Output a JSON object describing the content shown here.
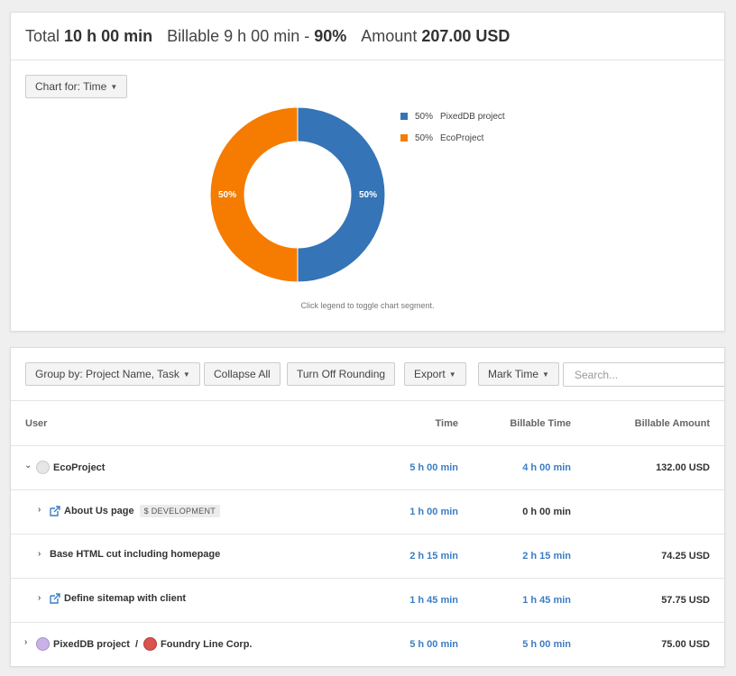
{
  "summary": {
    "total_label": "Total",
    "total_value": "10 h 00 min",
    "billable_label": "Billable",
    "billable_value": "9 h 00 min",
    "billable_sep": "-",
    "billable_pct": "90%",
    "amount_label": "Amount",
    "amount_value": "207.00 USD"
  },
  "chart_controls": {
    "chart_for_label": "Chart for: Time",
    "hint": "Click legend to toggle chart segment."
  },
  "chart_data": {
    "type": "pie",
    "donut": true,
    "categories": [
      "PixedDB project",
      "EcoProject"
    ],
    "values": [
      50,
      50
    ],
    "colors": [
      "#3574b6",
      "#f57c00"
    ],
    "slice_labels": [
      "50%",
      "50%"
    ],
    "legend": [
      {
        "pct": "50%",
        "name": "PixedDB project",
        "color": "#3574b6"
      },
      {
        "pct": "50%",
        "name": "EcoProject",
        "color": "#f57c00"
      }
    ],
    "legend_position": "right"
  },
  "toolbar": {
    "group_by_label": "Group by: Project Name, Task",
    "collapse_all_label": "Collapse All",
    "rounding_label": "Turn Off Rounding",
    "export_label": "Export",
    "mark_time_label": "Mark Time",
    "search_placeholder": "Search..."
  },
  "table": {
    "headers": {
      "user": "User",
      "time": "Time",
      "billable_time": "Billable Time",
      "billable_amount": "Billable Amount"
    },
    "rows": [
      {
        "name": "EcoProject",
        "time": "5 h 00 min",
        "billable_time": "4 h 00 min",
        "amount": "132.00 USD"
      },
      {
        "name": "About Us page",
        "tag": "$ DEVELOPMENT",
        "time": "1 h 00 min",
        "billable_time": "0 h 00 min",
        "amount": ""
      },
      {
        "name": "Base HTML cut including homepage",
        "time": "2 h 15 min",
        "billable_time": "2 h 15 min",
        "amount": "74.25 USD"
      },
      {
        "name": "Define sitemap with client",
        "time": "1 h 45 min",
        "billable_time": "1 h 45 min",
        "amount": "57.75 USD"
      },
      {
        "name": "PixedDB project",
        "client_sep": "/",
        "client": "Foundry Line Corp.",
        "time": "5 h 00 min",
        "billable_time": "5 h 00 min",
        "amount": "75.00 USD"
      }
    ]
  },
  "colors": {
    "accent_blue": "#3b7dc4",
    "orange": "#f57c00",
    "chart_blue": "#3574b6"
  }
}
